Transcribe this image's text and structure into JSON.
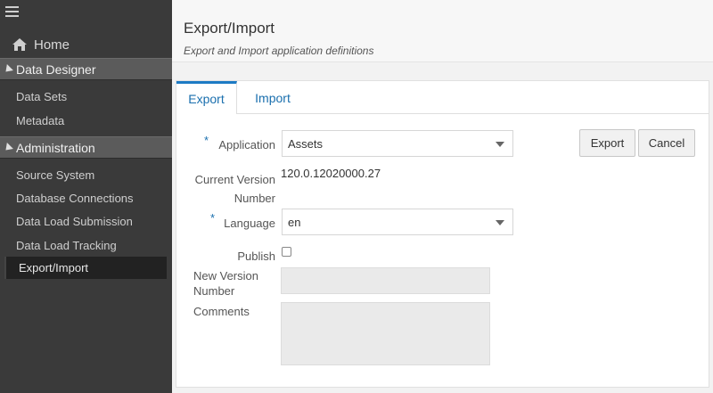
{
  "sidebar": {
    "home_label": "Home",
    "sections": [
      {
        "label": "Data Designer",
        "items": [
          "Data Sets",
          "Metadata"
        ]
      },
      {
        "label": "Administration",
        "items": [
          "Source System",
          "Database Connections",
          "Data Load Submission",
          "Data Load Tracking",
          "Export/Import"
        ]
      }
    ],
    "active_item": "Export/Import"
  },
  "header": {
    "title": "Export/Import",
    "subtitle": "Export and Import application definitions"
  },
  "tabs": [
    {
      "label": "Export",
      "active": true
    },
    {
      "label": "Import",
      "active": false
    }
  ],
  "form": {
    "required_marker": "*",
    "application_label": "Application",
    "application_value": "Assets",
    "current_version_label_line1": "Current Version",
    "current_version_label_line2": "Number",
    "current_version_value": "120.0.12020000.27",
    "language_label": "Language",
    "language_value": "en",
    "publish_label": "Publish",
    "publish_checked": false,
    "new_version_label_line1": "New Version",
    "new_version_label_line2": "Number",
    "new_version_value": "",
    "comments_label": "Comments",
    "comments_value": ""
  },
  "buttons": {
    "export_label": "Export",
    "cancel_label": "Cancel"
  },
  "colors": {
    "sidebar_bg": "#3a3a3a",
    "section_bg": "#5b5b5b",
    "accent": "#1d7ac4"
  }
}
